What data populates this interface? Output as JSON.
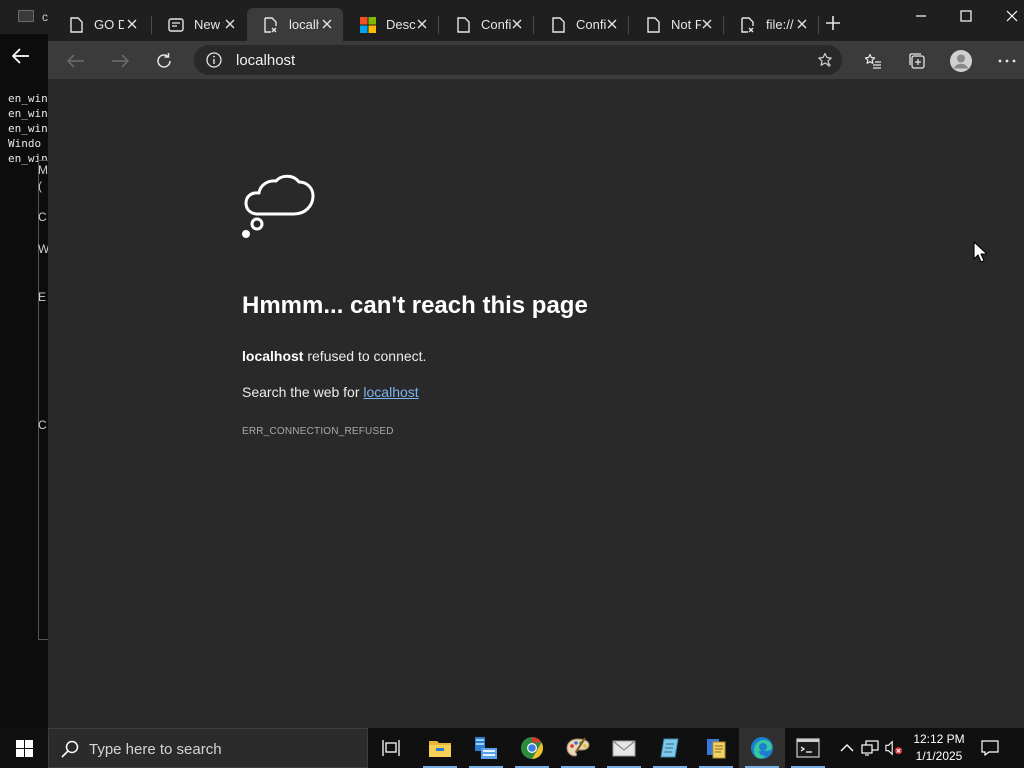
{
  "background_window": {
    "title": "cr",
    "console_lines": [
      "en_win",
      "en_win",
      "en_win",
      "Windo",
      "en_win"
    ],
    "dialog_letters": [
      "M",
      "(",
      "C",
      "W",
      "E",
      "C"
    ]
  },
  "browser": {
    "tabs": [
      {
        "title": "GO D",
        "icon": "page-icon",
        "active": false
      },
      {
        "title": "New t",
        "icon": "new-tab-page-icon",
        "active": false
      },
      {
        "title": "localh",
        "icon": "error-page-icon",
        "active": true
      },
      {
        "title": "Descr",
        "icon": "microsoft-logo-icon",
        "active": false
      },
      {
        "title": "Confi",
        "icon": "page-icon",
        "active": false
      },
      {
        "title": "Confi",
        "icon": "page-icon",
        "active": false
      },
      {
        "title": "Not F",
        "icon": "page-icon",
        "active": false
      },
      {
        "title": "file://",
        "icon": "error-page-icon",
        "active": false
      }
    ],
    "address": {
      "url": "localhost"
    }
  },
  "error_page": {
    "title": "Hmmm... can't reach this page",
    "host": "localhost",
    "message": "refused to connect.",
    "search_prefix": "Search the web for",
    "search_link": "localhost",
    "code": "ERR_CONNECTION_REFUSED"
  },
  "taskbar": {
    "search_placeholder": "Type here to search",
    "apps": [
      "task-view",
      "file-explorer",
      "server-manager",
      "chrome",
      "paint-app",
      "mail-app",
      "notepad-app",
      "office-app",
      "edge",
      "terminal"
    ],
    "clock": {
      "time": "12:12 PM",
      "date": "1/1/2025"
    }
  },
  "colors": {
    "page_bg": "#292929",
    "toolbar_bg": "#3b3b3b",
    "tabstrip_bg": "#1f1f1f",
    "link": "#7fb2f0",
    "taskbar_bg": "#101010"
  }
}
